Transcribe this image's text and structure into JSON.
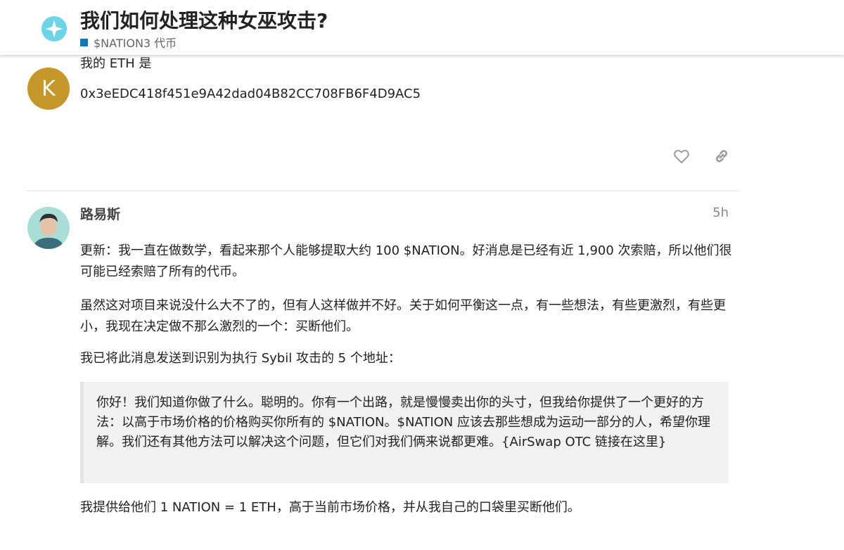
{
  "header": {
    "title": "我们如何处理这种女巫攻击?",
    "category": "$NATION3 代币",
    "category_color": "#0e76bd",
    "logo_icon": "nation3-star-logo"
  },
  "previous_post": {
    "avatar_letter": "K",
    "avatar_color": "#c5962a",
    "line1": "我的 ETH 是",
    "line2": "0x3eEDC418f451e9A42dad04B82CC708FB6F4D9AC5",
    "actions": [
      "heart-icon",
      "link-icon"
    ]
  },
  "post": {
    "username": "路易斯",
    "time": "5h",
    "p1": "更新：我一直在做数学，看起来那个人能够提取大约 100 $NATION。好消息是已经有近 1,900 次索赔，所以他们很可能已经索赔了所有的代币。",
    "p2": "虽然这对项目来说没什么大不了的，但有人这样做并不好。关于如何平衡这一点，有一些想法，有些更激烈，有些更小，我现在决定做不那么激烈的一个：买断他们。",
    "p3": "我已将此消息发送到识别为执行 Sybil 攻击的 5 个地址：",
    "quote": "你好！我们知道你做了什么。聪明的。你有一个出路，就是慢慢卖出你的头寸，但我给你提供了一个更好的方法：以高于市场价格的价格购买你所有的 $NATION。$NATION 应该去那些想成为运动一部分的人，希望你理解。我们还有其他方法可以解决这个问题，但它们对我们俩来说都更难。{AirSwap OTC 链接在这里}",
    "p4": "我提供给他们 1 NATION = 1 ETH，高于当前市场价格，并从我自己的口袋里买断他们。"
  }
}
